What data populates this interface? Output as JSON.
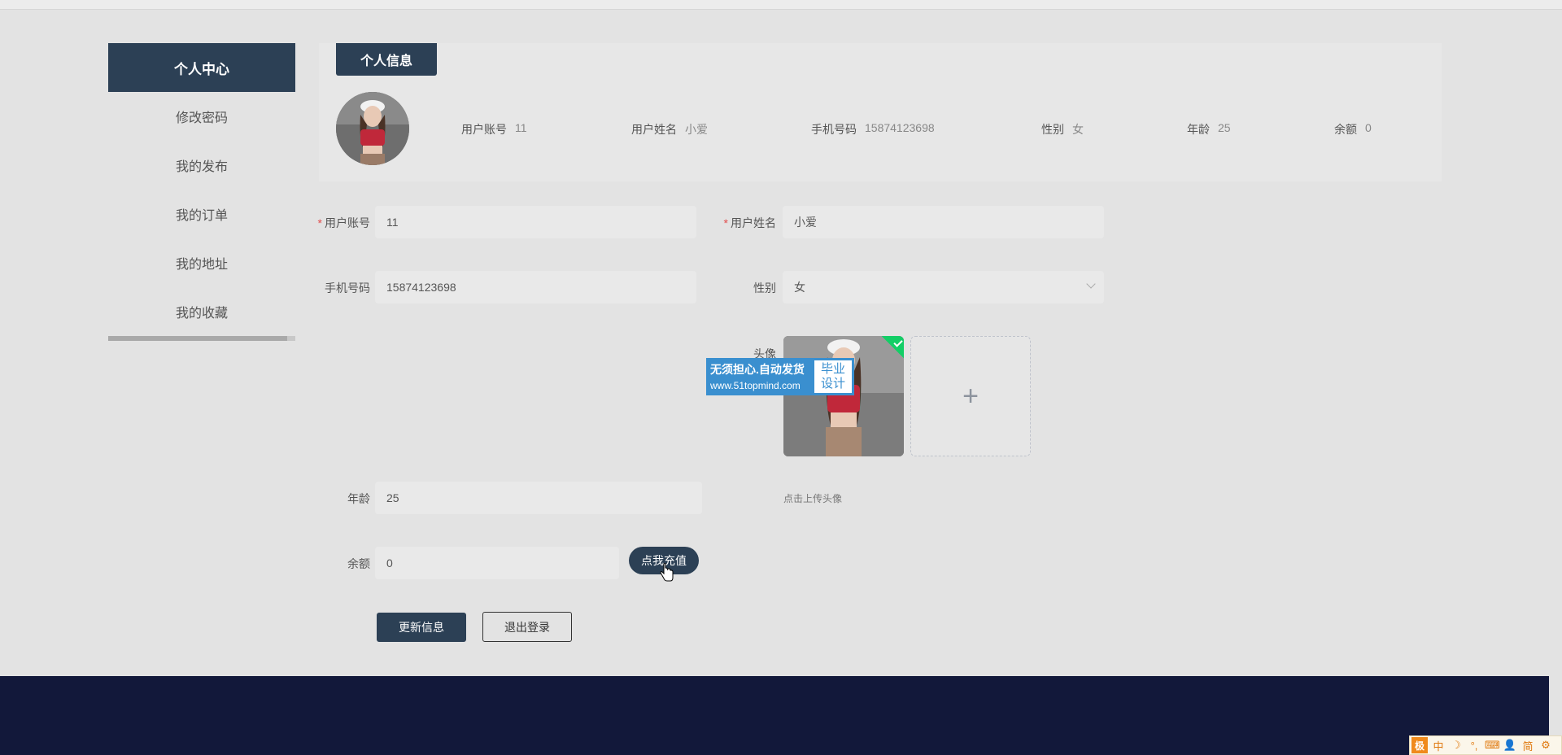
{
  "sidebar": {
    "header": "个人中心",
    "items": [
      {
        "label": "修改密码"
      },
      {
        "label": "我的发布"
      },
      {
        "label": "我的订单"
      },
      {
        "label": "我的地址"
      },
      {
        "label": "我的收藏"
      }
    ]
  },
  "info": {
    "tab": "个人信息",
    "fields": [
      {
        "key": "用户账号",
        "value": "11"
      },
      {
        "key": "用户姓名",
        "value": "小爱"
      },
      {
        "key": "手机号码",
        "value": "15874123698"
      },
      {
        "key": "性别",
        "value": "女"
      },
      {
        "key": "年龄",
        "value": "25"
      },
      {
        "key": "余额",
        "value": "0"
      }
    ]
  },
  "form": {
    "account_label": "用户账号",
    "account_value": "11",
    "name_label": "用户姓名",
    "name_value": "小爱",
    "phone_label": "手机号码",
    "phone_value": "15874123698",
    "gender_label": "性别",
    "gender_value": "女",
    "avatar_label": "头像",
    "upload_tip": "点击上传头像",
    "age_label": "年龄",
    "age_value": "25",
    "balance_label": "余额",
    "balance_value": "0",
    "recharge_button": "点我充值",
    "update_button": "更新信息",
    "logout_button": "退出登录"
  },
  "watermark": {
    "line1": "无须担心.自动发货",
    "line2": "www.51topmind.com",
    "badge1": "毕业",
    "badge2": "设计"
  },
  "ime": {
    "logo": "极",
    "items": [
      "中",
      "☽",
      "°,",
      "⌨",
      "👤",
      "简",
      "⚙"
    ]
  },
  "colors": {
    "primary": "#2c4055",
    "footer": "#12183a",
    "success": "#13ce66",
    "required": "#e24b4b"
  }
}
